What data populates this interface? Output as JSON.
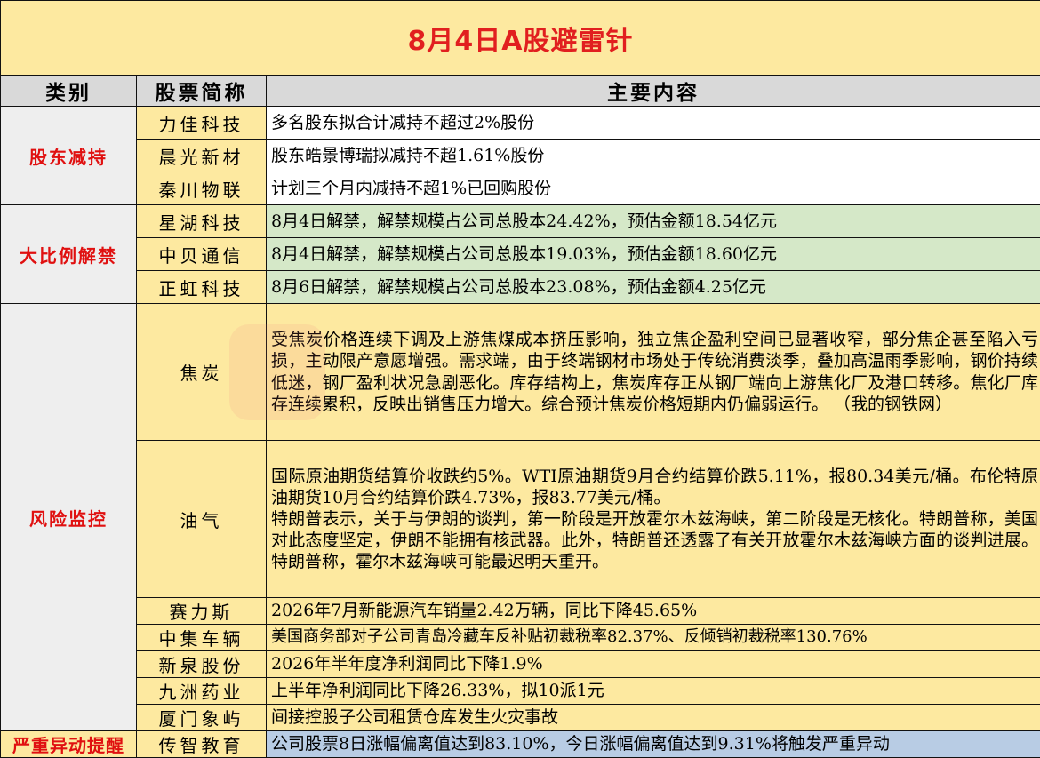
{
  "title": "8月4日A股避雷针",
  "headers": {
    "category": "类别",
    "stock": "股票简称",
    "content": "主要内容"
  },
  "sections": [
    {
      "category": "股东减持",
      "rows": [
        {
          "stock": "力佳科技",
          "content": "多名股东拟合计减持不超过2%股份"
        },
        {
          "stock": "晨光新材",
          "content": "股东皓景博瑞拟减持不超1.61%股份"
        },
        {
          "stock": "秦川物联",
          "content": "计划三个月内减持不超1%已回购股份"
        }
      ]
    },
    {
      "category": "大比例解禁",
      "rows": [
        {
          "stock": "星湖科技",
          "content": "8月4日解禁，解禁规模占公司总股本24.42%，预估金额18.54亿元"
        },
        {
          "stock": "中贝通信",
          "content": "8月4日解禁，解禁规模占公司总股本19.03%，预估金额18.60亿元"
        },
        {
          "stock": "正虹科技",
          "content": "8月6日解禁，解禁规模占公司总股本23.08%，预估金额4.25亿元"
        }
      ]
    },
    {
      "category": "风险监控",
      "rows": [
        {
          "stock": "焦炭",
          "content": "受焦炭价格连续下调及上游焦煤成本挤压影响，独立焦企盈利空间已显著收窄，部分焦企甚至陷入亏损，主动限产意愿增强。需求端，由于终端钢材市场处于传统消费淡季，叠加高温雨季影响，钢价持续低迷，钢厂盈利状况急剧恶化。库存结构上，焦炭库存正从钢厂端向上游焦化厂及港口转移。焦化厂库存连续累积，反映出销售压力增大。综合预计焦炭价格短期内仍偏弱运行。 （我的钢铁网）"
        },
        {
          "stock": "油气",
          "content": "国际原油期货结算价收跌约5%。WTI原油期货9月合约结算价跌5.11%，报80.34美元/桶。布伦特原油期货10月合约结算价跌4.73%，报83.77美元/桶。",
          "content2": "特朗普表示，关于与伊朗的谈判，第一阶段是开放霍尔木兹海峡，第二阶段是无核化。特朗普称，美国对此态度坚定，伊朗不能拥有核武器。此外，特朗普还透露了有关开放霍尔木兹海峡方面的谈判进展。特朗普称，霍尔木兹海峡可能最迟明天重开。"
        },
        {
          "stock": "赛力斯",
          "content": "2026年7月新能源汽车销量2.42万辆，同比下降45.65%"
        },
        {
          "stock": "中集车辆",
          "content": "美国商务部对子公司青岛冷藏车反补贴初裁税率82.37%、反倾销初裁税率130.76%"
        },
        {
          "stock": "新泉股份",
          "content": "2026年半年度净利润同比下降1.9%"
        },
        {
          "stock": "九洲药业",
          "content": "上半年净利润同比下降26.33%，拟10派1元"
        },
        {
          "stock": "厦门象屿",
          "content": "间接控股子公司租赁仓库发生火灾事故"
        }
      ]
    },
    {
      "category": "严重异动提醒",
      "rows": [
        {
          "stock": "传智教育",
          "content": "公司股票8日涨幅偏离值达到83.10%，今日涨幅偏离值达到9.31%将触发严重异动"
        }
      ]
    }
  ]
}
